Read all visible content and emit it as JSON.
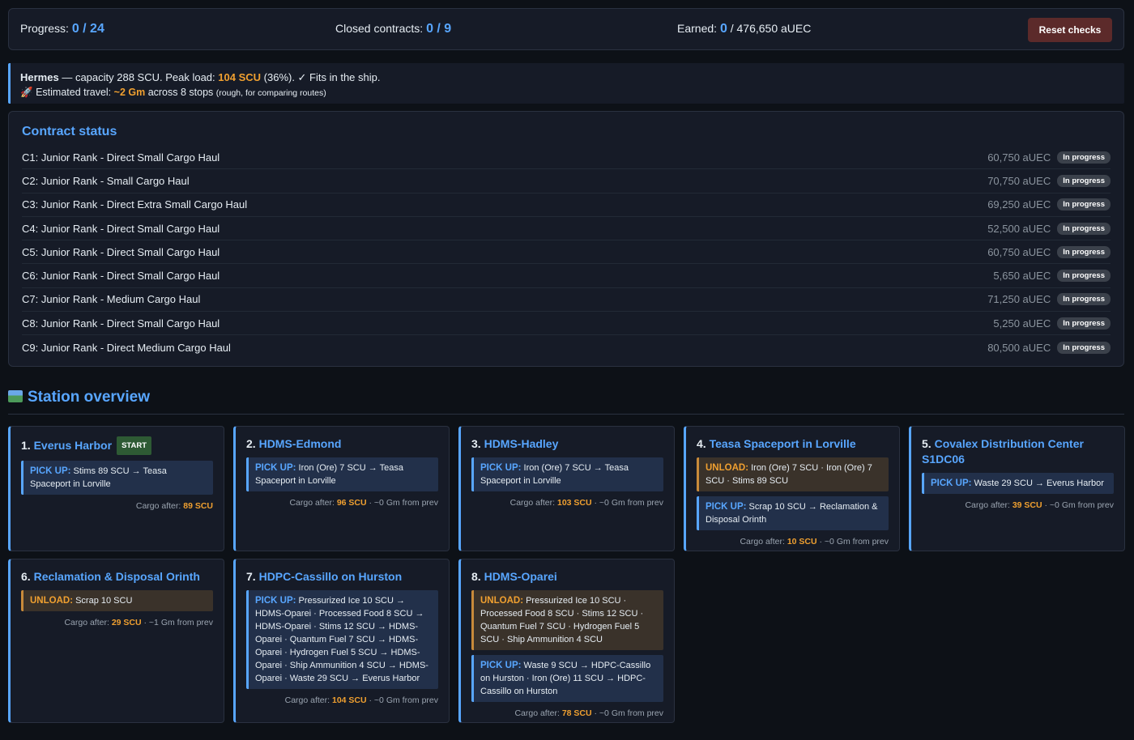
{
  "topbar": {
    "progress_label": "Progress:",
    "progress_value": "0 / 24",
    "closed_label": "Closed contracts:",
    "closed_value": "0 / 9",
    "earned_label": "Earned:",
    "earned_value": "0",
    "earned_total": "/ 476,650 aUEC",
    "reset_label": "Reset checks"
  },
  "info": {
    "ship": "Hermes",
    "capacity_text": "— capacity 288 SCU. Peak load:",
    "peak": "104 SCU",
    "peak_suffix": "(36%). ✓ Fits in the ship.",
    "travel_icon": "🚀",
    "travel_label": "Estimated travel:",
    "travel_value": "~2 Gm",
    "travel_suffix": "across 8 stops",
    "travel_note": "(rough, for comparing routes)"
  },
  "contracts": {
    "title": "Contract status",
    "status_label": "In progress",
    "items": [
      {
        "name": "C1: Junior Rank - Direct Small Cargo Haul",
        "amount": "60,750 aUEC"
      },
      {
        "name": "C2: Junior Rank - Small Cargo Haul",
        "amount": "70,750 aUEC"
      },
      {
        "name": "C3: Junior Rank - Direct Extra Small Cargo Haul",
        "amount": "69,250 aUEC"
      },
      {
        "name": "C4: Junior Rank - Direct Small Cargo Haul",
        "amount": "52,500 aUEC"
      },
      {
        "name": "C5: Junior Rank - Direct Small Cargo Haul",
        "amount": "60,750 aUEC"
      },
      {
        "name": "C6: Junior Rank - Direct Small Cargo Haul",
        "amount": "5,650 aUEC"
      },
      {
        "name": "C7: Junior Rank - Medium Cargo Haul",
        "amount": "71,250 aUEC"
      },
      {
        "name": "C8: Junior Rank - Direct Small Cargo Haul",
        "amount": "5,250 aUEC"
      },
      {
        "name": "C9: Junior Rank - Direct Medium Cargo Haul",
        "amount": "80,500 aUEC"
      }
    ]
  },
  "overview": {
    "title": "Station overview",
    "icon": "map-icon",
    "pickup_label": "PICK UP:",
    "unload_label": "UNLOAD:",
    "cargo_label": "Cargo after:",
    "stations": [
      {
        "num": "1.",
        "name": "Everus Harbor",
        "badge": "START",
        "actions": [
          {
            "type": "pickup",
            "text": "Stims 89 SCU → Teasa Spaceport in Lorville"
          }
        ],
        "cargo": "89 SCU",
        "dist": ""
      },
      {
        "num": "2.",
        "name": "HDMS-Edmond",
        "actions": [
          {
            "type": "pickup",
            "text": "Iron (Ore) 7 SCU → Teasa Spaceport in Lorville"
          }
        ],
        "cargo": "96 SCU",
        "dist": "· ~0 Gm from prev"
      },
      {
        "num": "3.",
        "name": "HDMS-Hadley",
        "actions": [
          {
            "type": "pickup",
            "text": "Iron (Ore) 7 SCU → Teasa Spaceport in Lorville"
          }
        ],
        "cargo": "103 SCU",
        "dist": "· ~0 Gm from prev"
      },
      {
        "num": "4.",
        "name": "Teasa Spaceport in Lorville",
        "actions": [
          {
            "type": "unload",
            "text": "Iron (Ore) 7 SCU · Iron (Ore) 7 SCU · Stims 89 SCU"
          },
          {
            "type": "pickup",
            "text": "Scrap 10 SCU → Reclamation & Disposal Orinth"
          }
        ],
        "cargo": "10 SCU",
        "dist": "· ~0 Gm from prev"
      },
      {
        "num": "5.",
        "name": "Covalex Distribution Center S1DC06",
        "actions": [
          {
            "type": "pickup",
            "text": "Waste 29 SCU → Everus Harbor"
          }
        ],
        "cargo": "39 SCU",
        "dist": "· ~0 Gm from prev"
      },
      {
        "num": "6.",
        "name": "Reclamation & Disposal Orinth",
        "actions": [
          {
            "type": "unload",
            "text": "Scrap 10 SCU"
          }
        ],
        "cargo": "29 SCU",
        "dist": "· ~1 Gm from prev"
      },
      {
        "num": "7.",
        "name": "HDPC-Cassillo on Hurston",
        "actions": [
          {
            "type": "pickup",
            "text": "Pressurized Ice 10 SCU → HDMS-Oparei · Processed Food 8 SCU → HDMS-Oparei · Stims 12 SCU → HDMS-Oparei · Quantum Fuel 7 SCU → HDMS-Oparei · Hydrogen Fuel 5 SCU → HDMS-Oparei · Ship Ammunition 4 SCU → HDMS-Oparei · Waste 29 SCU → Everus Harbor"
          }
        ],
        "cargo": "104 SCU",
        "dist": "· ~0 Gm from prev"
      },
      {
        "num": "8.",
        "name": "HDMS-Oparei",
        "actions": [
          {
            "type": "unload",
            "text": "Pressurized Ice 10 SCU · Processed Food 8 SCU · Stims 12 SCU · Quantum Fuel 7 SCU · Hydrogen Fuel 5 SCU · Ship Ammunition 4 SCU"
          },
          {
            "type": "pickup",
            "text": "Waste 9 SCU → HDPC-Cassillo on Hurston · Iron (Ore) 11 SCU → HDPC-Cassillo on Hurston"
          }
        ],
        "cargo": "78 SCU",
        "dist": "· ~0 Gm from prev"
      }
    ]
  }
}
